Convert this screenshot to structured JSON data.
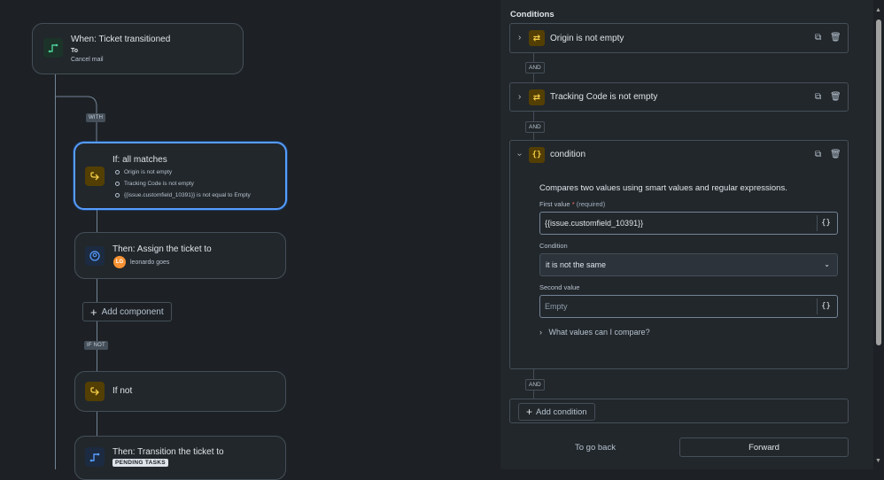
{
  "flow": {
    "trigger": {
      "title": "When: Ticket transitioned",
      "to_label": "To",
      "to_value": "Cancel mail"
    },
    "with_tag": "WITH",
    "if_block": {
      "title": "If: all matches",
      "conditions": [
        "Origin is not empty",
        "Tracking Code is not empty",
        "{{issue.customfield_10391}} is not equal to Empty"
      ]
    },
    "assign": {
      "title": "Then: Assign the ticket to",
      "avatar_initials": "LG",
      "user": "leonardo goes"
    },
    "add_component": "Add component",
    "if_not_tag": "IF NOT",
    "if_not": {
      "title": "If not"
    },
    "transition": {
      "title": "Then: Transition the ticket to",
      "status": "PENDING TASKS"
    }
  },
  "panel": {
    "heading": "Conditions",
    "conditions": [
      {
        "label": "Origin is not empty",
        "icon": "swap-icon"
      },
      {
        "label": "Tracking Code is not empty",
        "icon": "swap-icon"
      },
      {
        "label": "condition",
        "icon": "braces-icon"
      }
    ],
    "and_label": "AND",
    "detail": {
      "description": "Compares two values using smart values and regular expressions.",
      "first_value_label": "First value",
      "required_mark": "*",
      "required_text": "(required)",
      "first_value": "{{issue.customfield_10391}}",
      "condition_label": "Condition",
      "condition_value": "it is not the same",
      "second_value_label": "Second value",
      "second_value_placeholder": "Empty",
      "compare_link": "What values can I compare?"
    },
    "add_condition": "Add condition",
    "back_button": "To go back",
    "forward_button": "Forward"
  },
  "colors": {
    "accent": "#579dff",
    "background": "#1d2125",
    "condition_icon": "#f5cd47"
  }
}
